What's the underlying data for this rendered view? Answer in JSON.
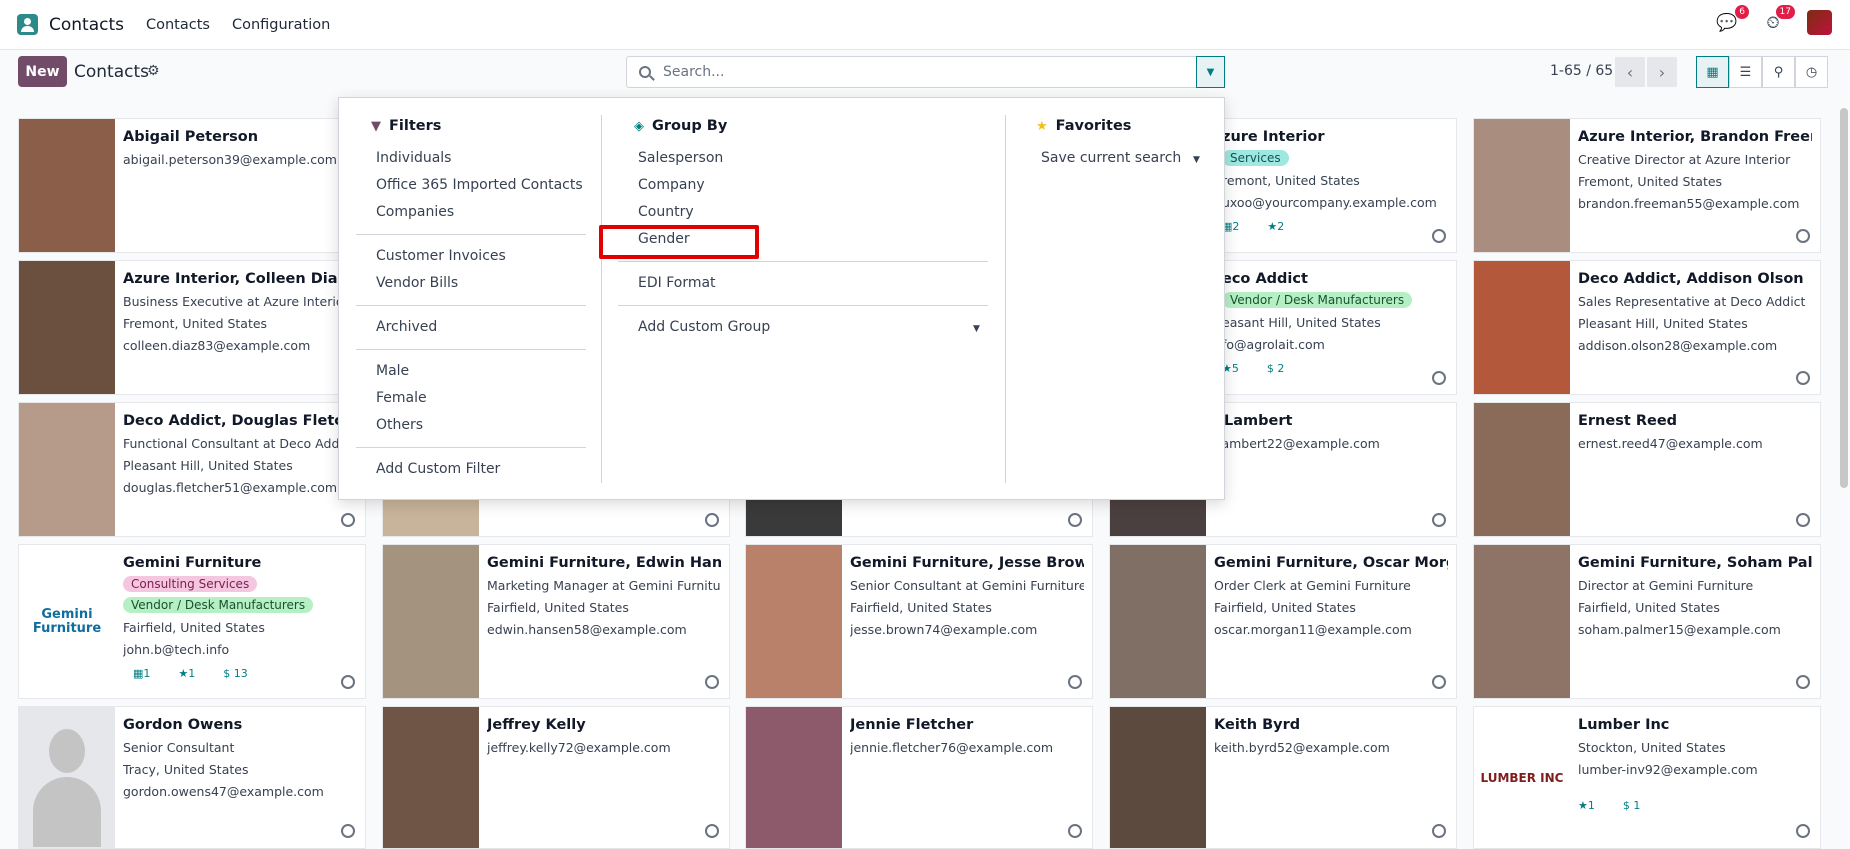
{
  "navbar": {
    "app_name": "Contacts",
    "menu": [
      "Contacts",
      "Configuration"
    ],
    "messages_count": "6",
    "activities_count": "17"
  },
  "control": {
    "new_label": "New",
    "title": "Contacts",
    "search_placeholder": "Search...",
    "pager": "1-65 / 65"
  },
  "filters": {
    "title": "Filters",
    "group1": [
      "Individuals",
      "Office 365 Imported Contacts",
      "Companies"
    ],
    "group2": [
      "Customer Invoices",
      "Vendor Bills"
    ],
    "group3": [
      "Archived"
    ],
    "group4": [
      "Male",
      "Female",
      "Others"
    ],
    "add_custom": "Add Custom Filter"
  },
  "group_by": {
    "title": "Group By",
    "items": [
      "Salesperson",
      "Company",
      "Country",
      "Gender"
    ],
    "edi": "EDI Format",
    "add_custom": "Add Custom Group"
  },
  "favorites": {
    "title": "Favorites",
    "save_search": "Save current search"
  },
  "cards": {
    "c1": {
      "name": "Abigail Peterson",
      "email": "abigail.peterson39@example.com"
    },
    "c4": {
      "name": "zure Interior",
      "tag": "Services",
      "loc": "remont, United States",
      "email": "uxoo@yourcompany.example.com",
      "stats": [
        "2",
        "2"
      ]
    },
    "c5": {
      "name": "Azure Interior, Brandon Freeman",
      "job": "Creative Director at Azure Interior",
      "loc": "Fremont, United States",
      "email": "brandon.freeman55@example.com"
    },
    "c6": {
      "name": "Azure Interior, Colleen Diaz",
      "job": "Business Executive at Azure Interior",
      "loc": "Fremont, United States",
      "email": "colleen.diaz83@example.com"
    },
    "c9": {
      "name": "eco Addict",
      "tag": "Vendor / Desk Manufacturers",
      "loc": "easant Hill, United States",
      "email": "fo@agrolait.com",
      "stats": [
        "5",
        "2"
      ]
    },
    "c10": {
      "name": "Deco Addict, Addison Olson",
      "job": "Sales Representative at Deco Addict",
      "loc": "Pleasant Hill, United States",
      "email": "addison.olson28@example.com"
    },
    "c11": {
      "name": "Deco Addict, Douglas Fletcher",
      "job": "Functional Consultant at Deco Addict",
      "loc": "Pleasant Hill, United States",
      "email": "douglas.fletcher51@example.com"
    },
    "c14": {
      "name": "i Lambert",
      "email": ".lambert22@example.com"
    },
    "c15": {
      "name": "Ernest Reed",
      "email": "ernest.reed47@example.com"
    },
    "c16": {
      "name": "Gemini Furniture",
      "tag1": "Consulting Services",
      "tag2": "Vendor / Desk Manufacturers",
      "loc": "Fairfield, United States",
      "email": "john.b@tech.info",
      "stats": [
        "1",
        "1",
        "13"
      ]
    },
    "c17": {
      "name": "Gemini Furniture, Edwin Hansen",
      "job": "Marketing Manager at Gemini Furniture",
      "loc": "Fairfield, United States",
      "email": "edwin.hansen58@example.com"
    },
    "c18": {
      "name": "Gemini Furniture, Jesse Brown",
      "job": "Senior Consultant at Gemini Furniture",
      "loc": "Fairfield, United States",
      "email": "jesse.brown74@example.com"
    },
    "c19": {
      "name": "Gemini Furniture, Oscar Morgan",
      "job": "Order Clerk at Gemini Furniture",
      "loc": "Fairfield, United States",
      "email": "oscar.morgan11@example.com"
    },
    "c20": {
      "name": "Gemini Furniture, Soham Palmer",
      "job": "Director at Gemini Furniture",
      "loc": "Fairfield, United States",
      "email": "soham.palmer15@example.com"
    },
    "c21": {
      "name": "Gordon Owens",
      "job": "Senior Consultant",
      "loc": "Tracy, United States",
      "email": "gordon.owens47@example.com"
    },
    "c22": {
      "name": "Jeffrey Kelly",
      "email": "jeffrey.kelly72@example.com"
    },
    "c23": {
      "name": "Jennie Fletcher",
      "email": "jennie.fletcher76@example.com"
    },
    "c24": {
      "name": "Keith Byrd",
      "email": "keith.byrd52@example.com"
    },
    "c25": {
      "name": "Lumber Inc",
      "loc": "Stockton, United States",
      "email": "lumber-inv92@example.com",
      "stats": [
        "1",
        "1"
      ]
    }
  },
  "logos": {
    "gemini": "Gemini Furniture",
    "lumber": "LUMBER INC"
  }
}
